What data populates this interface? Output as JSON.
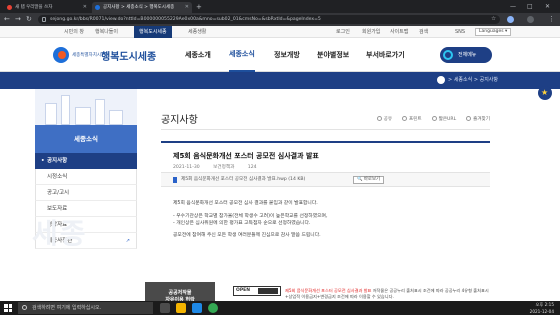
{
  "browser": {
    "tabs": [
      {
        "label": "새 탭 우리말을 쓰자"
      },
      {
        "label": "공지사항 > 세종소식 > 행복도시세종"
      }
    ],
    "new_tab": "+",
    "url": "sejong.go.kr/bbs/R0071/view.do?nttId=B000000055229Ae0x00a&mno=sub02_01&cmsNo=&sbRxtld=&pageIndex=5",
    "window_controls": {
      "minimize": "—",
      "maximize": "□",
      "close": "✕"
    },
    "nav": {
      "back": "←",
      "forward": "→",
      "reload": "↻"
    }
  },
  "utility": {
    "links": [
      "시민의 창",
      "행복나들이",
      "행복도시세종",
      "세종생활"
    ],
    "right_links": [
      "로그인",
      "회원가입",
      "사이트맵",
      "검색",
      "SNS"
    ],
    "language": "Languages"
  },
  "gnb": {
    "logo_sub": "세종특별자치시",
    "logo_main": "행복도시세종",
    "menus": [
      "세종소개",
      "세종소식",
      "정보개방",
      "분야별정보",
      "부서바로가기"
    ],
    "all_menu": "전체메뉴"
  },
  "breadcrumb": "> 세종소식 > 공지사항",
  "sidebar": {
    "title": "세종소식",
    "items": [
      {
        "label": "공지사항"
      },
      {
        "label": "시정소식"
      },
      {
        "label": "공고/고시"
      },
      {
        "label": "보도자료"
      },
      {
        "label": "영상자료"
      },
      {
        "label": "세종사진관"
      }
    ],
    "watermark": "세종",
    "banner": "공공저작물\n자유이용 허락"
  },
  "content": {
    "page_title": "공지사항",
    "tools": [
      "공유",
      "프린트",
      "짧은URL",
      "즐겨찾기"
    ],
    "post": {
      "title": "제5회 음식문화개선 포스터 공모전 심사결과 발표",
      "date": "2021-11-30",
      "dept": "보건정책과",
      "views": "124",
      "attachment": "제5회 음식문화개선 포스터 공모전 심사결과 발표.hwp (14 KB)",
      "view_button": "바로보기",
      "body": [
        "제5회 음식문화개선 포스터 공모전 심사 결과를 붙임과 같이 발표합니다.",
        "- 우수기관상은 학교별 참가율(전체 학생수 고려)이 높은학교를 선정하였으며,",
        "- 개인상은 심사위원에 의한 평가표 고득점자 순으로 선정하였습니다.",
        "공모전에 참여해 주신 모든 학생 여러분들께 진심으로 감사 말씀 드립니다."
      ]
    },
    "kogl_label": "OPEN",
    "kogl_text_red": "제5회 음식문화개선 포스터 공모전 심사결과 발표",
    "kogl_text": " 저작물은 공공누리 출처표시 조건에 따라 공공누리 4유형 출처표시+상업적 이용금지+변경금지 조건에 따라 이용할 수 있습니다."
  },
  "taskbar": {
    "search_placeholder": "검색하려면 여기에 입력하십시오.",
    "time": "오후 2:15",
    "date": "2021-12-04"
  },
  "colors": {
    "brand_navy": "#1e3f85",
    "sidebar_blue": "#3f6fc4",
    "accent_orange": "#f15a24"
  }
}
